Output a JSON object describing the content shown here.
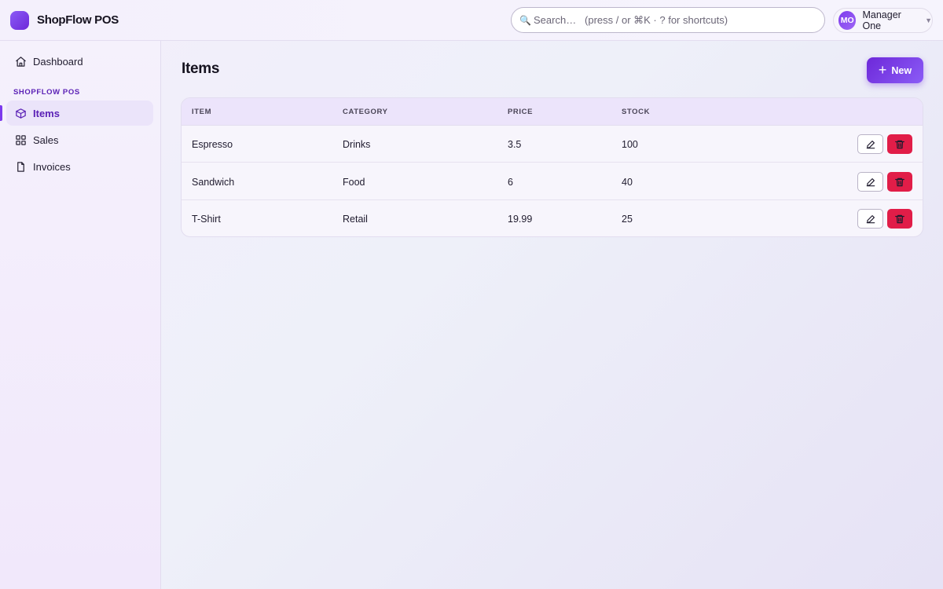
{
  "app": {
    "name": "ShopFlow POS"
  },
  "search": {
    "placeholder": "Search…   (press / or ⌘K · ? for shortcuts)",
    "icon": "search-icon"
  },
  "user": {
    "initials": "MO",
    "name": "Manager One"
  },
  "sidebar": {
    "dashboard": {
      "label": "Dashboard",
      "icon": "home-icon"
    },
    "section_label": "SHOPFLOW POS",
    "items": [
      {
        "label": "Items",
        "icon": "box-icon",
        "active": true
      },
      {
        "label": "Sales",
        "icon": "grid-icon",
        "active": false
      },
      {
        "label": "Invoices",
        "icon": "file-icon",
        "active": false
      }
    ]
  },
  "main": {
    "title": "Items",
    "new_button": "New",
    "table": {
      "columns": [
        "ITEM",
        "CATEGORY",
        "PRICE",
        "STOCK"
      ],
      "rows": [
        {
          "item": "Espresso",
          "category": "Drinks",
          "price": "3.5",
          "stock": "100"
        },
        {
          "item": "Sandwich",
          "category": "Food",
          "price": "6",
          "stock": "40"
        },
        {
          "item": "T-Shirt",
          "category": "Retail",
          "price": "19.99",
          "stock": "25"
        }
      ]
    }
  },
  "colors": {
    "accent": "#7c3aed",
    "danger": "#e11d48"
  }
}
